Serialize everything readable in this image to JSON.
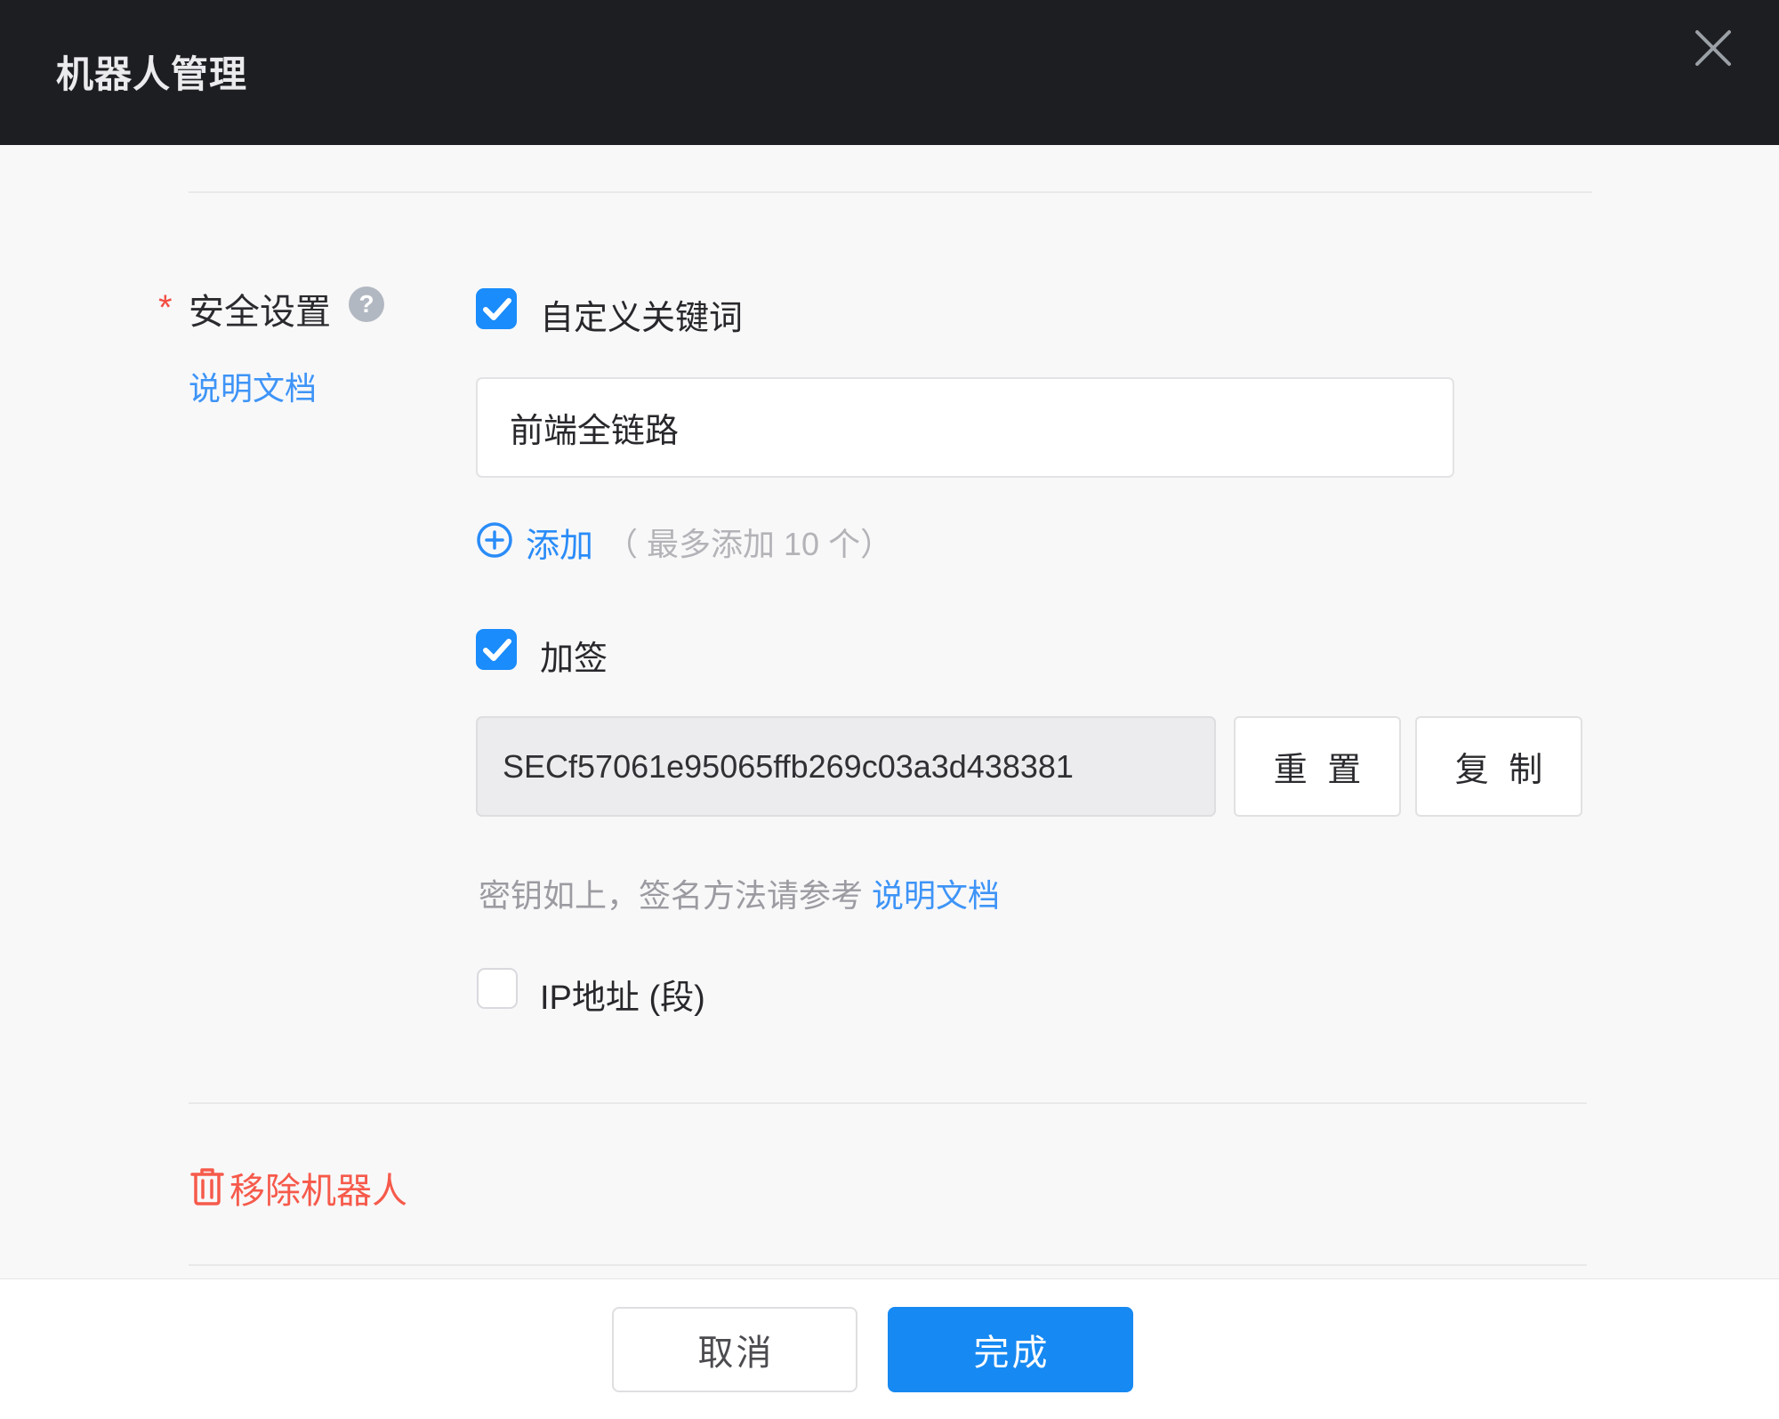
{
  "header": {
    "title": "机器人管理"
  },
  "security": {
    "required_mark": "*",
    "label": "安全设置",
    "help_glyph": "?",
    "doc_link": "说明文档",
    "keywords": {
      "checked": true,
      "label": "自定义关键词",
      "value": "前端全链路",
      "add_label": "添加",
      "add_hint": "（ 最多添加 10 个）"
    },
    "sign": {
      "checked": true,
      "label": "加签",
      "key": "SECf57061e95065ffb269c03a3d438381",
      "reset_label": "重 置",
      "copy_label": "复 制",
      "hint_prefix": "密钥如上，签名方法请参考",
      "hint_link": "说明文档"
    },
    "ip": {
      "checked": false,
      "label": "IP地址 (段)"
    }
  },
  "remove": {
    "label": "移除机器人"
  },
  "footer": {
    "cancel_label": "取消",
    "done_label": "完成"
  },
  "colors": {
    "header_bg": "#1d1e22",
    "accent_blue": "#1789f2",
    "checkbox_blue": "#1a8cfb",
    "link_blue": "#3e94f7",
    "danger_red": "#f65a4b",
    "hint_gray": "#9b9ba1",
    "disabled_input_bg": "#ececee"
  }
}
